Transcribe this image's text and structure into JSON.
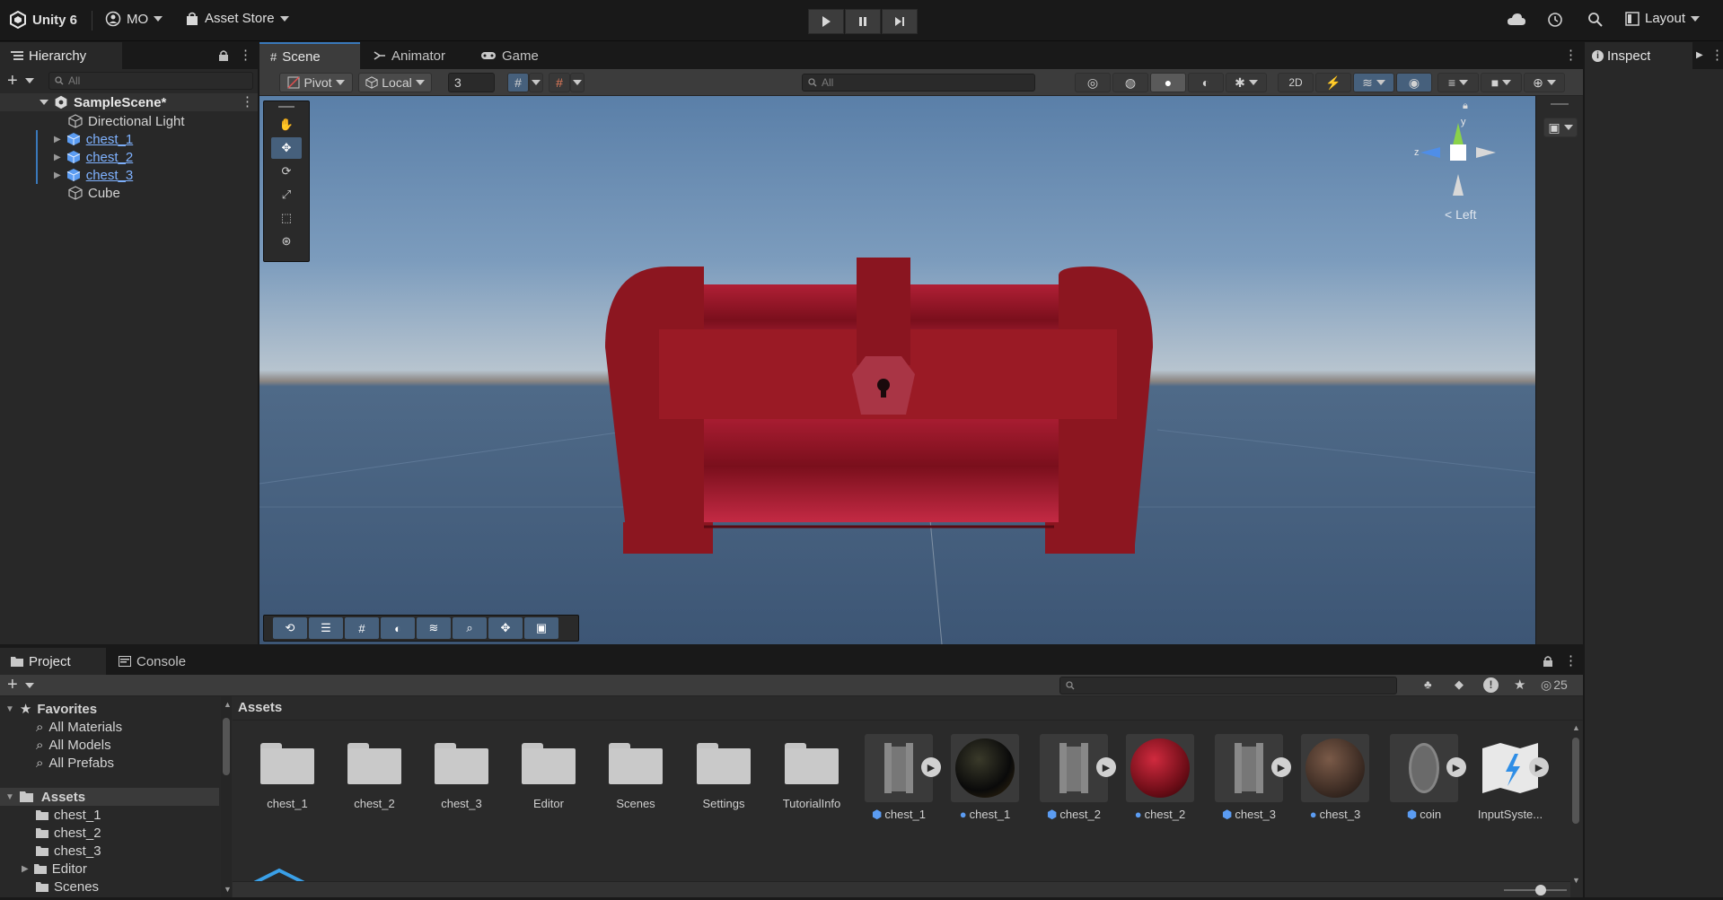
{
  "toolbar": {
    "app_name": "Unity 6",
    "account": "MO",
    "asset_store": "Asset Store",
    "layout": "Layout"
  },
  "hierarchy": {
    "tab": "Hierarchy",
    "search_placeholder": "All",
    "scene_name": "SampleScene*",
    "items": [
      {
        "label": "Directional Light"
      },
      {
        "label": "chest_1"
      },
      {
        "label": "chest_2"
      },
      {
        "label": "chest_3"
      },
      {
        "label": "Cube"
      }
    ]
  },
  "scene_tabs": [
    "Scene",
    "Animator",
    "Game"
  ],
  "scene_toolbar": {
    "pivot": "Pivot",
    "local": "Local",
    "snap_value": "3",
    "search_placeholder": "All"
  },
  "gizmo": {
    "y": "y",
    "z": "z",
    "view": "< Left"
  },
  "inspector": {
    "tab": "Inspect"
  },
  "project": {
    "tabs": [
      "Project",
      "Console"
    ],
    "favorites": {
      "title": "Favorites",
      "items": [
        "All Materials",
        "All Models",
        "All Prefabs"
      ]
    },
    "assets_tree": {
      "title": "Assets",
      "items": [
        "chest_1",
        "chest_2",
        "chest_3",
        "Editor",
        "Scenes"
      ]
    },
    "breadcrumb": "Assets",
    "hidden_count": "25",
    "assets": [
      {
        "label": "chest_1",
        "kind": "folder"
      },
      {
        "label": "chest_2",
        "kind": "folder"
      },
      {
        "label": "chest_3",
        "kind": "folder"
      },
      {
        "label": "Editor",
        "kind": "folder"
      },
      {
        "label": "Scenes",
        "kind": "folder"
      },
      {
        "label": "Settings",
        "kind": "folder"
      },
      {
        "label": "TutorialInfo",
        "kind": "folder"
      },
      {
        "label": "chest_1",
        "kind": "model"
      },
      {
        "label": "chest_1",
        "kind": "material"
      },
      {
        "label": "chest_2",
        "kind": "model"
      },
      {
        "label": "chest_2",
        "kind": "material"
      },
      {
        "label": "chest_3",
        "kind": "model"
      },
      {
        "label": "chest_3",
        "kind": "material"
      },
      {
        "label": "coin",
        "kind": "model"
      },
      {
        "label": "InputSyste...",
        "kind": "input-actions"
      }
    ]
  },
  "colors": {
    "selection": "#46607c",
    "accent": "#3a79bb",
    "chest": "#9c1a22"
  }
}
